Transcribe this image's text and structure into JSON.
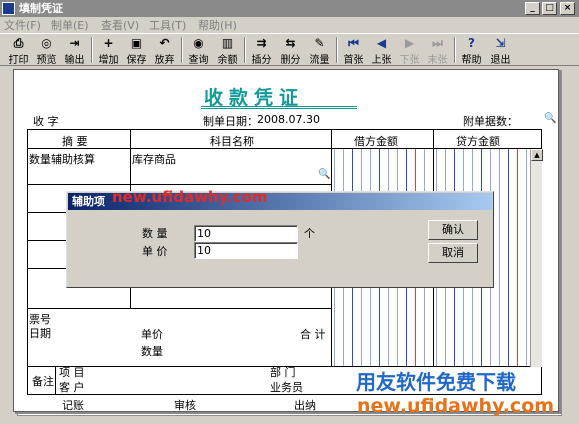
{
  "window": {
    "title": "填制凭证"
  },
  "menu": [
    "文件(F)",
    "制单(E)",
    "查看(V)",
    "工具(T)",
    "帮助(H)"
  ],
  "toolbar": [
    {
      "label": "打印",
      "icon": "printer-icon",
      "glyph": "⎙"
    },
    {
      "label": "预览",
      "icon": "preview-icon",
      "glyph": "◎"
    },
    {
      "label": "输出",
      "icon": "output-icon",
      "glyph": "⇥"
    },
    {
      "label": "增加",
      "icon": "add-icon",
      "glyph": "+"
    },
    {
      "label": "保存",
      "icon": "save-icon",
      "glyph": "▣"
    },
    {
      "label": "放弃",
      "icon": "undo-icon",
      "glyph": "↶"
    },
    {
      "label": "查询",
      "icon": "binoculars-icon",
      "glyph": "◉"
    },
    {
      "label": "余额",
      "icon": "balance-chart-icon",
      "glyph": "▥"
    },
    {
      "label": "插分",
      "icon": "insert-row-icon",
      "glyph": "⇉"
    },
    {
      "label": "删分",
      "icon": "delete-row-icon",
      "glyph": "⇆"
    },
    {
      "label": "流量",
      "icon": "flow-icon",
      "glyph": "✎"
    },
    {
      "label": "首张",
      "icon": "first-icon",
      "glyph": "⏮"
    },
    {
      "label": "上张",
      "icon": "prev-icon",
      "glyph": "◀"
    },
    {
      "label": "下张",
      "icon": "next-icon",
      "glyph": "▶"
    },
    {
      "label": "末张",
      "icon": "last-icon",
      "glyph": "⏭"
    },
    {
      "label": "帮助",
      "icon": "help-icon",
      "glyph": "?"
    },
    {
      "label": "退出",
      "icon": "exit-icon",
      "glyph": "⇲"
    }
  ],
  "voucher": {
    "title": "收款凭证",
    "type_label": "收 字",
    "date_label": "制单日期：",
    "date": "2008.07.30",
    "attach_label": "附单据数：",
    "col_summary": "摘 要",
    "col_account": "科目名称",
    "col_debit": "借方金额",
    "col_credit": "贷方金额",
    "row1_summary": "数量辅助核算",
    "row1_account": "库存商品",
    "ticket_label": "票号",
    "date2_label": "日期",
    "price_label": "单价",
    "qty_label": "数量",
    "total_label": "合 计",
    "remark_label": "备注",
    "project_label": "项 目",
    "customer_label": "客 户",
    "dept_label": "部 门",
    "staff_label": "业务员",
    "bookkeep_label": "记账",
    "audit_label": "审核",
    "cashier_label": "出纳"
  },
  "dialog": {
    "title": "辅助项",
    "qty_label": "数 量",
    "qty_value": "10",
    "unit": "个",
    "price_label": "单 价",
    "price_value": "10",
    "ok": "确认",
    "cancel": "取消"
  },
  "watermarks": {
    "url_top": "new.ufidawhy.com",
    "banner": "用友软件免费下载",
    "url_bottom": "new.ufidawhy.com"
  }
}
